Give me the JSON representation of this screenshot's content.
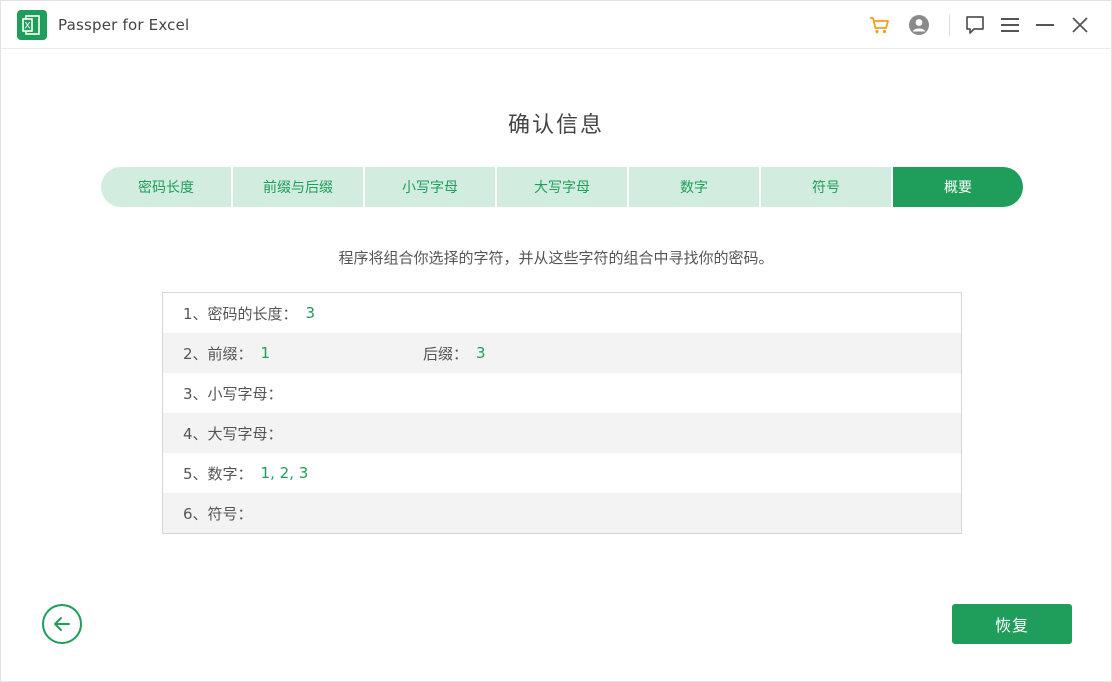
{
  "app": {
    "title": "Passper for Excel",
    "logo_letter": "X",
    "accent_color": "#1e9e5a",
    "cart_color": "#f0a020"
  },
  "titlebar": {
    "icons": [
      "cart-icon",
      "account-icon",
      "feedback-icon",
      "menu-icon",
      "minimize-icon",
      "close-icon"
    ]
  },
  "page": {
    "title": "确认信息",
    "description": "程序将组合你选择的字符，并从这些字符的组合中寻找你的密码。"
  },
  "steps": [
    {
      "label": "密码长度",
      "active": false
    },
    {
      "label": "前缀与后缀",
      "active": false
    },
    {
      "label": "小写字母",
      "active": false
    },
    {
      "label": "大写字母",
      "active": false
    },
    {
      "label": "数字",
      "active": false
    },
    {
      "label": "符号",
      "active": false
    },
    {
      "label": "概要",
      "active": true
    }
  ],
  "summary": {
    "rows": [
      {
        "label": "1、密码的长度：",
        "value": "3"
      },
      {
        "label": "2、前缀：",
        "value": "1",
        "label2": "后缀：",
        "value2": "3"
      },
      {
        "label": "3、小写字母：",
        "value": ""
      },
      {
        "label": "4、大写字母：",
        "value": ""
      },
      {
        "label": "5、数字：",
        "value": "1, 2, 3"
      },
      {
        "label": "6、符号：",
        "value": ""
      }
    ]
  },
  "actions": {
    "back_icon": "arrow-left-icon",
    "recover_label": "恢复"
  }
}
